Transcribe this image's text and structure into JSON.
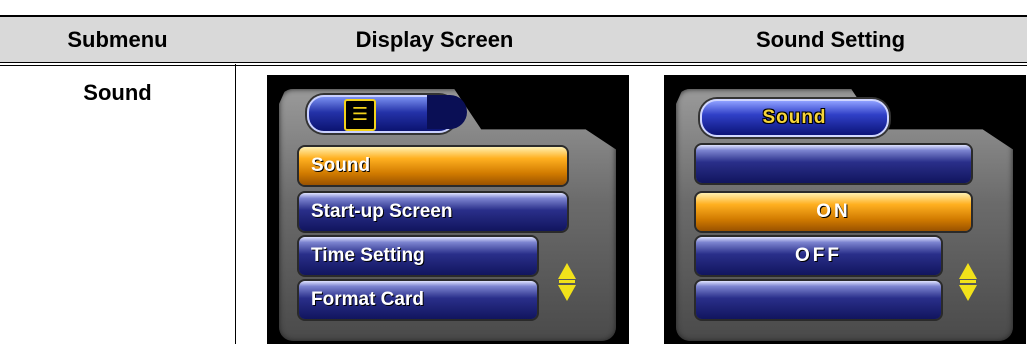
{
  "table": {
    "headers": [
      "Submenu",
      "Display Screen",
      "Sound Setting"
    ],
    "row": {
      "submenu": "Sound"
    }
  },
  "display_screen": {
    "icon": "menu-list-icon",
    "items": [
      {
        "label": "Sound",
        "selected": true
      },
      {
        "label": "Start-up Screen",
        "selected": false
      },
      {
        "label": "Time Setting",
        "selected": false
      },
      {
        "label": "Format Card",
        "selected": false
      }
    ],
    "scroll_icon": "up-down-arrows-icon"
  },
  "sound_setting": {
    "title": "Sound",
    "options": [
      {
        "label": "",
        "selected": false
      },
      {
        "label": "ON",
        "selected": true
      },
      {
        "label": "OFF",
        "selected": false
      },
      {
        "label": "",
        "selected": false
      }
    ],
    "scroll_icon": "up-down-arrows-icon"
  },
  "colors": {
    "header_bg": "#d9d9d9",
    "menu_selected": "#ffb020",
    "menu_item": "#1a2070",
    "accent_yellow": "#f2e21a"
  }
}
